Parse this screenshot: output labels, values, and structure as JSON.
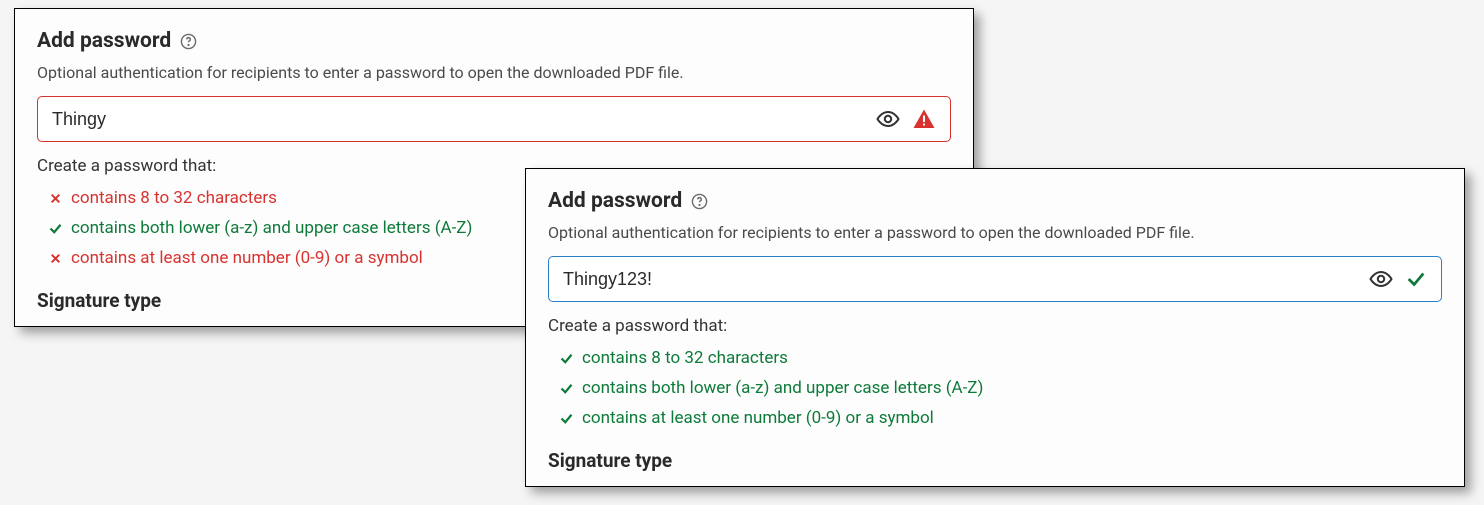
{
  "panelA": {
    "title": "Add password",
    "description": "Optional authentication for recipients to enter a password to open the downloaded PDF file.",
    "inputValue": "Thingy",
    "reqTitle": "Create a password that:",
    "reqs": [
      {
        "text": "contains 8 to 32 characters",
        "state": "fail"
      },
      {
        "text": "contains both lower (a-z) and upper case letters (A-Z)",
        "state": "pass"
      },
      {
        "text": "contains at least one number (0-9) or a symbol",
        "state": "fail"
      }
    ],
    "sigTitle": "Signature type"
  },
  "panelB": {
    "title": "Add password",
    "description": "Optional authentication for recipients to enter a password to open the downloaded PDF file.",
    "inputValue": "Thingy123!",
    "reqTitle": "Create a password that:",
    "reqs": [
      {
        "text": "contains 8 to 32 characters",
        "state": "pass"
      },
      {
        "text": "contains both lower (a-z) and upper case letters (A-Z)",
        "state": "pass"
      },
      {
        "text": "contains at least one number (0-9) or a symbol",
        "state": "pass"
      }
    ],
    "sigTitle": "Signature type"
  }
}
